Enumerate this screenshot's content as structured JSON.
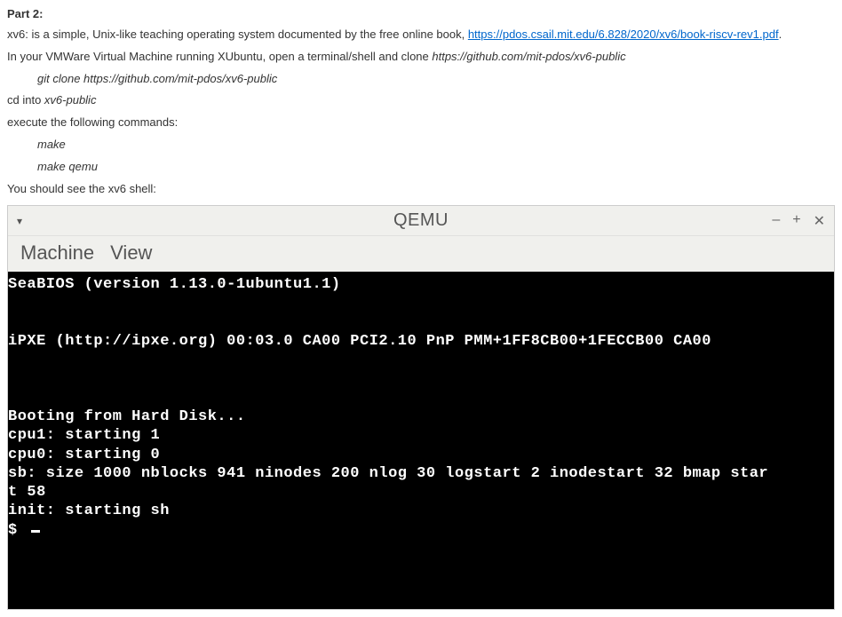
{
  "instructions": {
    "heading": "Part 2:",
    "line1_prefix": "xv6: is a simple, Unix-like teaching operating system documented by the free online book, ",
    "line1_link": "https://pdos.csail.mit.edu/6.828/2020/xv6/book-riscv-rev1.pdf",
    "line1_suffix": ".",
    "line2_prefix": "In your VMWare Virtual Machine running XUbuntu, open a terminal/shell and clone ",
    "line2_italic": "https://github.com/mit-pdos/xv6-public",
    "clone_cmd": "git clone https://github.com/mit-pdos/xv6-public",
    "cd_prefix": "cd into ",
    "cd_italic": "xv6-public",
    "exec_line": "execute the following commands:",
    "make_cmd": "make",
    "make_qemu_cmd": "make qemu",
    "shell_line": "You should see the xv6 shell:"
  },
  "qemu": {
    "title": "QEMU",
    "dropdown_glyph": "▾",
    "controls": {
      "minimize": "–",
      "maximize": "+",
      "close": "✕"
    },
    "menu": {
      "machine": "Machine",
      "view": "View"
    },
    "terminal": {
      "l1": "SeaBIOS (version 1.13.0-1ubuntu1.1)",
      "blank": "",
      "l2": "iPXE (http://ipxe.org) 00:03.0 CA00 PCI2.10 PnP PMM+1FF8CB00+1FECCB00 CA00",
      "l3": "Booting from Hard Disk...",
      "l4": "cpu1: starting 1",
      "l5": "cpu0: starting 0",
      "l6": "sb: size 1000 nblocks 941 ninodes 200 nlog 30 logstart 2 inodestart 32 bmap star",
      "l7": "t 58",
      "l8": "init: starting sh",
      "l9": "$ "
    }
  }
}
